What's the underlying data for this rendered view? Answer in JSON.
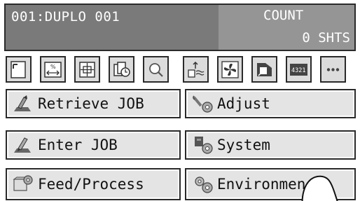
{
  "header": {
    "job_title": "001:DUPLO 001",
    "count_label": "COUNT",
    "count_value": "0 SHTS"
  },
  "toolbar": {
    "icons": [
      "paper-size-icon",
      "ratio-icon",
      "position-adjust-icon",
      "batch-icon",
      "zoom-icon",
      "stacker-icon",
      "fan-icon",
      "feed-icon",
      "counter-icon",
      "more-icon"
    ],
    "counter_text": "4321",
    "more_text": "•••"
  },
  "menu": {
    "retrieve_job": "Retrieve JOB",
    "adjust": "Adjust",
    "enter_job": "Enter JOB",
    "system": "System",
    "feed_process": "Feed/Process",
    "environment": "Environmen"
  }
}
